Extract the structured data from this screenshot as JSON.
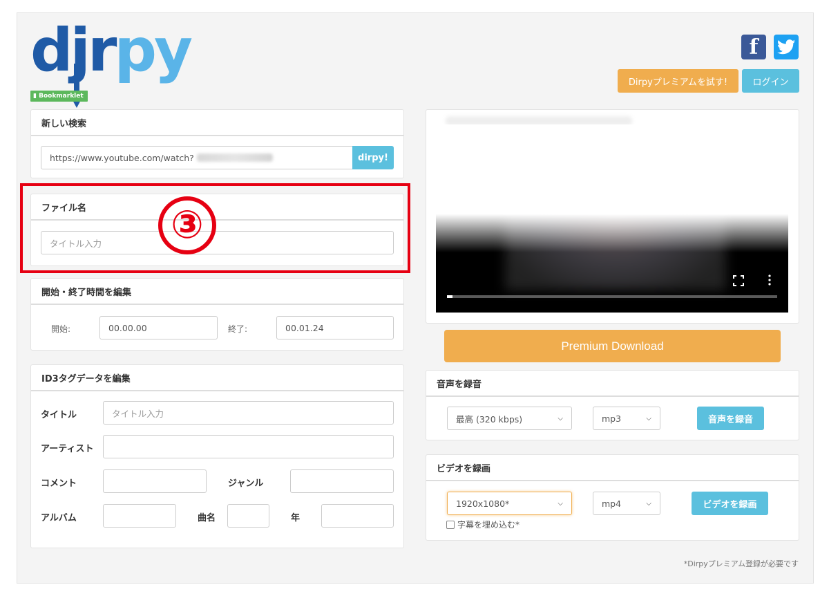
{
  "header": {
    "logo": {
      "text_dj": "dj",
      "text_r": "r",
      "text_py": "py"
    },
    "bookmarklet_label": "Bookmarklet",
    "social": {
      "facebook_letter": "f"
    },
    "premium_try_label": "Dirpyプレミアムを試す!",
    "login_label": "ログイン"
  },
  "search": {
    "heading": "新しい検索",
    "url_value": "https://www.youtube.com/watch?",
    "submit_label": "dirpy!"
  },
  "filename": {
    "heading": "ファイル名",
    "placeholder": "タイトル入力",
    "annotation": "③"
  },
  "time_edit": {
    "heading": "開始・終了時間を編集",
    "start_label": "開始:",
    "start_value": "00.00.00",
    "end_label": "終了:",
    "end_value": "00.01.24"
  },
  "id3": {
    "heading": "ID3タグデータを編集",
    "title_label": "タイトル",
    "title_placeholder": "タイトル入力",
    "artist_label": "アーティスト",
    "comment_label": "コメント",
    "genre_label": "ジャンル",
    "album_label": "アルバム",
    "track_label": "曲名",
    "year_label": "年"
  },
  "premium_download_label": "Premium Download",
  "audio": {
    "heading": "音声を録音",
    "quality_value": "最高 (320 kbps)",
    "format_value": "mp3",
    "record_label": "音声を録音"
  },
  "video_rec": {
    "heading": "ビデオを録画",
    "resolution_value": "1920x1080*",
    "format_value": "mp4",
    "record_label": "ビデオを録画",
    "subtitle_checkbox_label": "字幕を埋め込む*"
  },
  "footnote": "*Dirpyプレミアム登録が必要です",
  "colors": {
    "accent_orange": "#f0ad4e",
    "accent_blue": "#5bc0de",
    "annotation_red": "#e60012",
    "logo_dark": "#1f5aa6",
    "logo_light": "#5ab4e8"
  }
}
